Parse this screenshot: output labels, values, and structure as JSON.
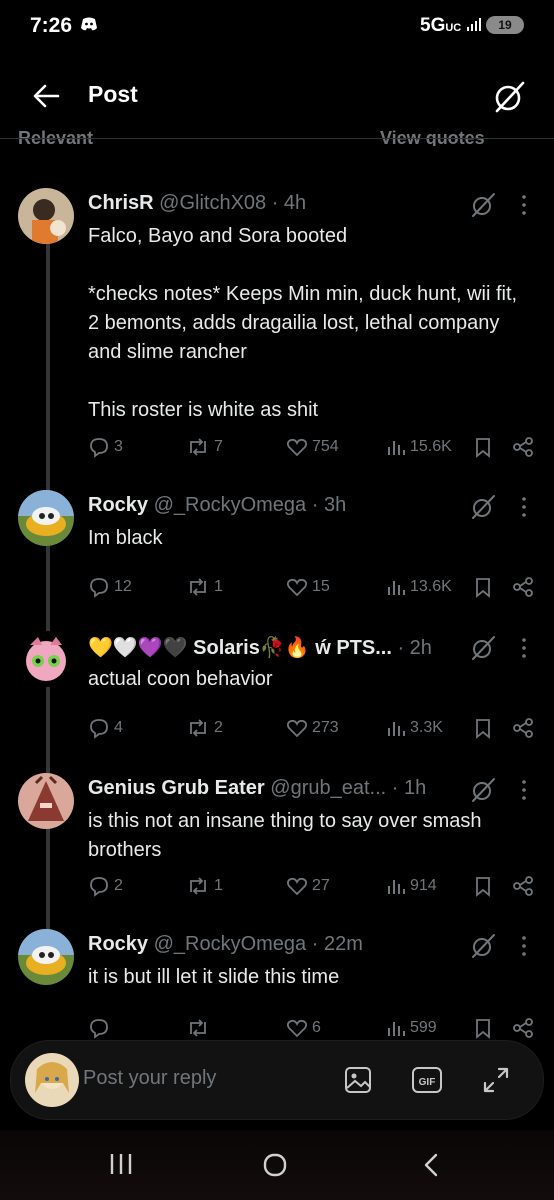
{
  "status_bar": {
    "time": "7:26",
    "network": "5G",
    "network_sub": "UC",
    "battery": "19"
  },
  "header": {
    "title": "Post",
    "cut_left": "Relevant",
    "cut_right": "View quotes"
  },
  "posts": [
    {
      "name": "ChrisR",
      "handle": "@GlitchX08 · 4h",
      "text": "Falco, Bayo and Sora booted\n\n*checks notes* Keeps Min min, duck hunt, wii fit, 2 bemonts, adds dragailia lost, lethal company and slime rancher\n\nThis roster is white as shit",
      "replies": "3",
      "reposts": "7",
      "likes": "754",
      "views": "15.6K"
    },
    {
      "name": "Rocky",
      "handle": "@_RockyOmega · 3h",
      "text": "Im black",
      "replies": "12",
      "reposts": "1",
      "likes": "15",
      "views": "13.6K"
    },
    {
      "name": "💛🤍💜🖤 Solaris🥀🔥 ẃ PTS...",
      "handle": " · 2h",
      "text": "actual coon behavior",
      "replies": "4",
      "reposts": "2",
      "likes": "273",
      "views": "3.3K"
    },
    {
      "name": "Genius Grub Eater",
      "handle": "@grub_eat... · 1h",
      "text": "is this not an insane thing to say over smash brothers",
      "replies": "2",
      "reposts": "1",
      "likes": "27",
      "views": "914"
    },
    {
      "name": "Rocky",
      "handle": "@_RockyOmega · 22m",
      "text": "it is but ill let it slide this time",
      "replies": "",
      "reposts": "",
      "likes": "6",
      "views": "599"
    }
  ],
  "composer": {
    "placeholder": "Post your reply",
    "gif_label": "GIF"
  },
  "icons": {
    "header": [
      "back-arrow-icon",
      "grok-icon"
    ],
    "post": [
      "grok-icon",
      "more-vertical-icon",
      "reply-icon",
      "repost-icon",
      "heart-icon",
      "views-icon",
      "bookmark-icon",
      "share-icon"
    ],
    "composer": [
      "image-icon",
      "gif-icon",
      "expand-icon"
    ],
    "nav": [
      "recents-icon",
      "home-icon",
      "back-icon"
    ]
  },
  "colors": {
    "background": "#000000",
    "text": "#e7e9ea",
    "secondary": "#71767b",
    "divider": "#2f3336"
  }
}
